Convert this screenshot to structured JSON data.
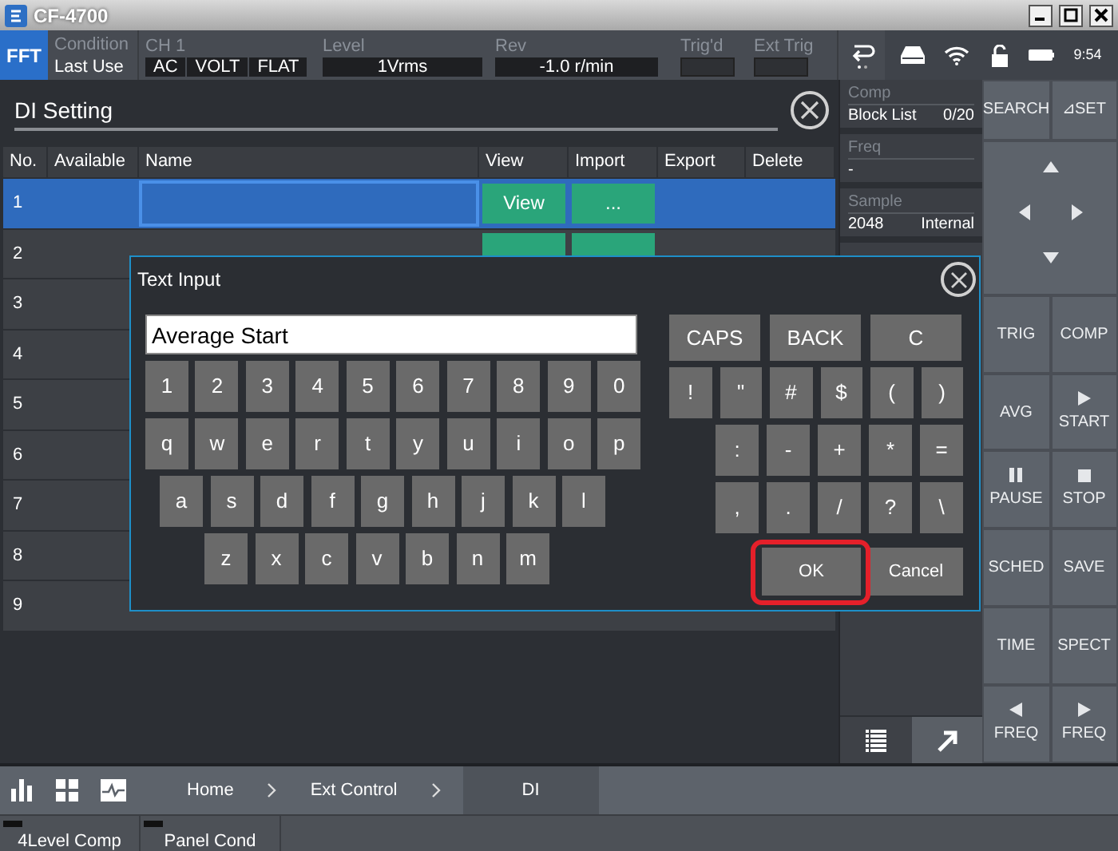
{
  "window": {
    "title": "CF-4700"
  },
  "status": {
    "mode": "FFT",
    "condition_label": "Condition",
    "condition_value": "Last Use",
    "channel_label": "CH 1",
    "channel_settings": [
      "AC",
      "VOLT",
      "FLAT"
    ],
    "level_label": "Level",
    "level_value": "1Vrms",
    "rev_label": "Rev",
    "rev_value": "-1.0 r/min",
    "trig_label": "Trig'd",
    "ext_trig_label": "Ext Trig",
    "time": "9:54"
  },
  "panel": {
    "title": "DI Setting",
    "columns": [
      "No.",
      "Available",
      "Name",
      "View",
      "Import",
      "Export",
      "Delete"
    ],
    "rows": [
      {
        "no": "1",
        "selected": true,
        "view": "View",
        "import": "..."
      },
      {
        "no": "2",
        "selected": false,
        "view_button": true,
        "import_button": true
      },
      {
        "no": "3",
        "selected": false
      },
      {
        "no": "4",
        "selected": false
      },
      {
        "no": "5",
        "selected": false
      },
      {
        "no": "6",
        "selected": false
      },
      {
        "no": "7",
        "selected": false
      },
      {
        "no": "8",
        "selected": false
      },
      {
        "no": "9",
        "selected": false
      }
    ]
  },
  "info": [
    {
      "label": "Comp",
      "value": "Block List",
      "extra": "0/20"
    },
    {
      "label": "Freq",
      "value": "-"
    },
    {
      "label": "Sample",
      "value": "2048",
      "extra": "Internal"
    }
  ],
  "keys": [
    {
      "kind": "pair",
      "buttons": [
        {
          "label": "SEARCH",
          "kind": "plain"
        },
        {
          "label": "⊿SET",
          "kind": "plain"
        }
      ]
    },
    {
      "kind": "dpad"
    },
    {
      "kind": "pair",
      "buttons": [
        {
          "label": "TRIG",
          "kind": "plain"
        },
        {
          "label": "COMP",
          "kind": "plain"
        }
      ]
    },
    {
      "kind": "pair",
      "buttons": [
        {
          "label": "AVG",
          "kind": "plain"
        },
        {
          "label": "START",
          "kind": "play"
        }
      ]
    },
    {
      "kind": "pair",
      "buttons": [
        {
          "label": "PAUSE",
          "kind": "pause"
        },
        {
          "label": "STOP",
          "kind": "stop"
        }
      ]
    },
    {
      "kind": "pair",
      "buttons": [
        {
          "label": "SCHED",
          "kind": "plain"
        },
        {
          "label": "SAVE",
          "kind": "plain"
        }
      ]
    },
    {
      "kind": "pair",
      "buttons": [
        {
          "label": "TIME",
          "kind": "plain"
        },
        {
          "label": "SPECT",
          "kind": "plain"
        }
      ]
    },
    {
      "kind": "pair",
      "buttons": [
        {
          "label": "FREQ",
          "kind": "left"
        },
        {
          "label": "FREQ",
          "kind": "play"
        }
      ]
    }
  ],
  "breadcrumb": [
    {
      "label": "Home",
      "selected": false
    },
    {
      "label": "Ext Control",
      "selected": false
    },
    {
      "label": "DI",
      "selected": true
    }
  ],
  "bottom_tabs": [
    "4Level Comp",
    "Panel Cond"
  ],
  "dialog": {
    "title": "Text Input",
    "value": "Average Start",
    "key_rows": [
      [
        "1",
        "2",
        "3",
        "4",
        "5",
        "6",
        "7",
        "8",
        "9",
        "0"
      ],
      [
        "q",
        "w",
        "e",
        "r",
        "t",
        "y",
        "u",
        "i",
        "o",
        "p"
      ],
      [
        "a",
        "s",
        "d",
        "f",
        "g",
        "h",
        "j",
        "k",
        "l"
      ],
      [
        "z",
        "x",
        "c",
        "v",
        "b",
        "n",
        "m"
      ]
    ],
    "function_keys": [
      "CAPS",
      "BACK",
      "C"
    ],
    "symbol_rows": [
      [
        "!",
        "\"",
        "#",
        "$",
        "(",
        ")"
      ],
      [
        ":",
        "-",
        "+",
        "*",
        "="
      ],
      [
        ",",
        ".",
        "/",
        "?",
        "\\"
      ]
    ],
    "ok": "OK",
    "ok_highlighted": true,
    "cancel": "Cancel"
  }
}
